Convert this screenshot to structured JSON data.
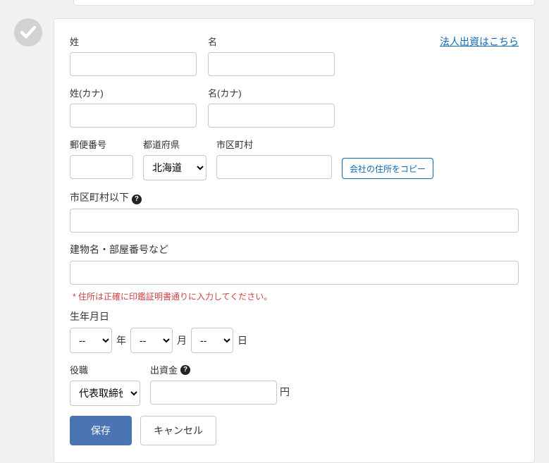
{
  "corner_link": "法人出資はこちら",
  "labels": {
    "last": "姓",
    "first": "名",
    "last_kana": "姓(カナ)",
    "first_kana": "名(カナ)",
    "zip": "郵便番号",
    "pref": "都道府県",
    "city": "市区町村",
    "city_below": "市区町村以下",
    "building": "建物名・部屋番号など",
    "birthdate": "生年月日",
    "position": "役職",
    "investment": "出資金"
  },
  "address_copy": "会社の住所をコピー",
  "pref_value": "北海道",
  "date": {
    "year_unit": "年",
    "month_unit": "月",
    "day_unit": "日",
    "year": "--",
    "month": "--",
    "day": "--"
  },
  "position_value": "代表取締役",
  "amount_unit": "円",
  "note": "* 住所は正確に印鑑証明書通りに入力してください。",
  "actions": {
    "save": "保存",
    "cancel": "キャンセル"
  }
}
